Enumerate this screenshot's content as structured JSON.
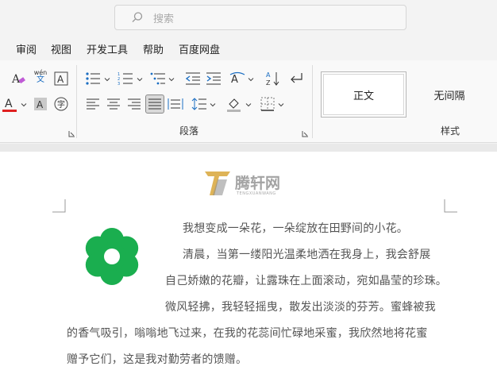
{
  "search": {
    "placeholder": "搜索"
  },
  "menu": {
    "items": [
      "审阅",
      "视图",
      "开发工具",
      "帮助",
      "百度网盘"
    ]
  },
  "ribbon": {
    "phonetic_top": "wén",
    "phonetic_bottom": "文",
    "paragraph_group_label": "段落",
    "styles_group_label": "样式",
    "styles": [
      "正文",
      "无间隔"
    ]
  },
  "logo": {
    "text": "腾轩网",
    "subtext": "TENGXUANWANG"
  },
  "document": {
    "lines": [
      "我想变成一朵花，一朵绽放在田野间的小花。",
      "清晨，当第一缕阳光温柔地洒在我身上，我会舒展",
      "自己娇嫩的花瓣，让露珠在上面滚动，宛如晶莹的珍珠。",
      "微风轻拂，我轻轻摇曳，散发出淡淡的芬芳。蜜蜂被我",
      "的香气吸引，嗡嗡地飞过来，在我的花蕊间忙碌地采蜜，我欣然地将花蜜",
      "赠予它们，这是我对勤劳者的馈赠。"
    ]
  },
  "colors": {
    "flower": "#1aae4f",
    "font_color_bar": "#e02020",
    "logo_gold": "#d8a63a"
  }
}
